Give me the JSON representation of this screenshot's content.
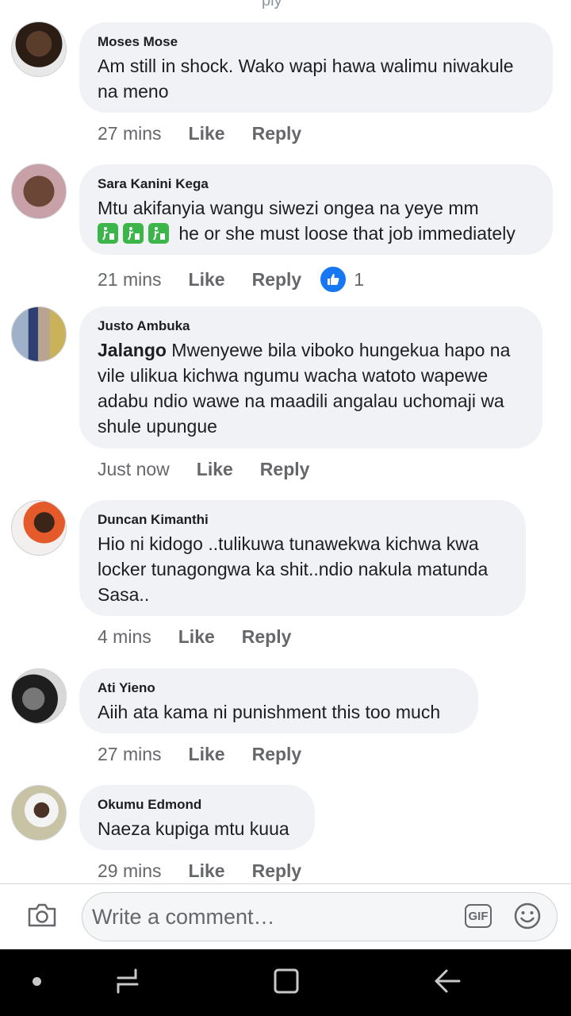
{
  "top_cut_text": "ply",
  "comments": [
    {
      "name": "Moses Mose",
      "text": "Am still in shock. Wako wapi hawa walimu niwakule na meno",
      "time": "27 mins",
      "like": "Like",
      "reply": "Reply"
    },
    {
      "name": "Sara Kanini Kega",
      "text_line1": "Mtu akifanyia wangu siwezi ongea na yeye mm",
      "text_line2": "he or she must loose that job immediately",
      "emoji_icon": "litter-in-bin-icon",
      "time": "21 mins",
      "like": "Like",
      "reply": "Reply",
      "reaction_count": "1",
      "reaction_icon": "thumbs-up-icon"
    },
    {
      "name": "Justo Ambuka",
      "mention": "Jalango",
      "text": " Mwenyewe bila viboko hungekua hapo na vile ulikua kichwa ngumu wacha watoto  wapewe adabu ndio wawe na maadili angalau uchomaji wa shule upungue",
      "time": "Just now",
      "like": "Like",
      "reply": "Reply"
    },
    {
      "name": "Duncan Kimanthi",
      "text": "Hio ni kidogo ..tulikuwa tunawekwa kichwa kwa locker tunagongwa ka shit..ndio nakula matunda Sasa..",
      "time": "4 mins",
      "like": "Like",
      "reply": "Reply"
    },
    {
      "name": "Ati Yieno",
      "text": "Aiih ata kama ni punishment this too much",
      "time": "27 mins",
      "like": "Like",
      "reply": "Reply"
    },
    {
      "name": "Okumu Edmond",
      "text": "Naeza kupiga mtu kuua",
      "time": "29 mins",
      "like": "Like",
      "reply": "Reply"
    }
  ],
  "composer": {
    "placeholder": "Write a comment…",
    "gif_label": "GIF",
    "camera_icon": "camera-icon",
    "emoji_icon": "smiley-icon"
  },
  "colors": {
    "bubble": "#f0f2f5",
    "meta": "#65676b",
    "like_blue": "#1877f2"
  }
}
